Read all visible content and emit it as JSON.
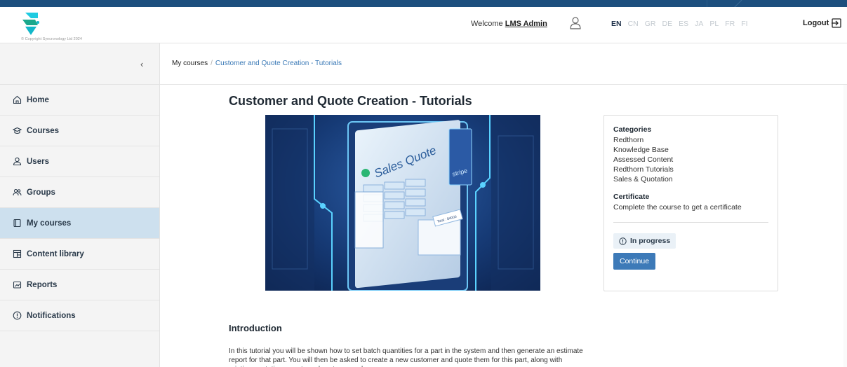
{
  "header": {
    "copyright": "© Copyright Syncronology Ltd 2024",
    "welcome_prefix": "Welcome",
    "user_name": "LMS Admin",
    "languages": [
      "EN",
      "CN",
      "GR",
      "DE",
      "ES",
      "JA",
      "PL",
      "FR",
      "FI"
    ],
    "active_language": "EN",
    "logout_label": "Logout"
  },
  "sidebar": {
    "collapse_glyph": "‹",
    "items": [
      {
        "label": "Home",
        "icon": "home-icon"
      },
      {
        "label": "Courses",
        "icon": "courses-icon"
      },
      {
        "label": "Users",
        "icon": "user-icon"
      },
      {
        "label": "Groups",
        "icon": "groups-icon"
      },
      {
        "label": "My courses",
        "icon": "book-icon",
        "active": true
      },
      {
        "label": "Content library",
        "icon": "library-icon"
      },
      {
        "label": "Reports",
        "icon": "reports-icon"
      },
      {
        "label": "Notifications",
        "icon": "alert-icon"
      }
    ]
  },
  "breadcrumb": {
    "first": "My courses",
    "separator": "/",
    "current": "Customer and Quote Creation - Tutorials"
  },
  "course": {
    "title": "Customer and Quote Creation - Tutorials",
    "image_text": {
      "quote": "Sales Quote",
      "stripe": "stripe",
      "total": "Total : $4000"
    },
    "categories_heading": "Categories",
    "categories": [
      "Redthorn",
      "Knowledge Base",
      "Assessed Content",
      "Redthorn Tutorials",
      "Sales & Quotation"
    ],
    "certificate_heading": "Certificate",
    "certificate_text": "Complete the course to get a certificate",
    "status_label": "In progress",
    "continue_label": "Continue",
    "intro_heading": "Introduction",
    "intro_text": "In this tutorial you will be shown how to set batch quantities for a part in the system and then generate an estimate report for that part. You will then be asked to create a new customer and quote them for this part, along with printing quotation reports and customer order"
  },
  "colors": {
    "brand_dark": "#1d4f7e",
    "accent": "#3d7ab8",
    "active_nav": "#cde0ee",
    "logo_teal": "#1ecbe1"
  }
}
